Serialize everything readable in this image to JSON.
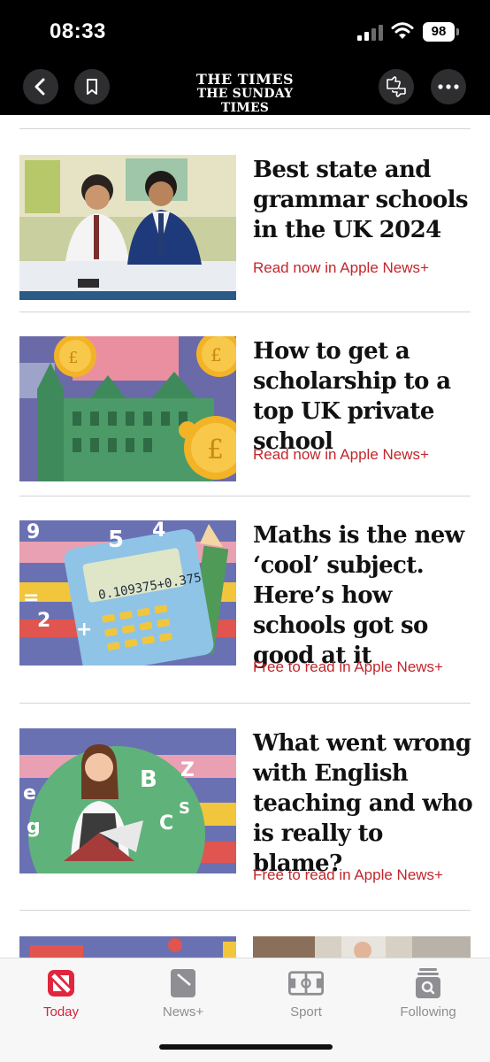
{
  "status_bar": {
    "time": "08:33",
    "battery": "98"
  },
  "header": {
    "masthead_line1": "THE TIMES",
    "masthead_line2": "THE SUNDAY TIMES",
    "icons": [
      "chevron-left-icon",
      "bookmark-icon",
      "thumbs-icon",
      "more-icon"
    ]
  },
  "articles": [
    {
      "headline": "Best state and grammar schools in the UK 2024",
      "cta": "Read now in Apple News+"
    },
    {
      "headline": "How to get a scholarship to a top UK private school",
      "cta": "Read now in Apple News+"
    },
    {
      "headline": "Maths is the new ‘cool’ subject. Here’s how schools got so good at it",
      "cta": "Free to read in Apple News+"
    },
    {
      "headline": "What went wrong with English teaching and who is really to blame?",
      "cta": "Free to read in Apple News+"
    }
  ],
  "tabbar": {
    "tabs": [
      {
        "label": "Today",
        "icon": "apple-news-icon",
        "active": true
      },
      {
        "label": "News+",
        "icon": "news-plus-icon",
        "active": false
      },
      {
        "label": "Sport",
        "icon": "sport-icon",
        "active": false
      },
      {
        "label": "Following",
        "icon": "following-icon",
        "active": false
      }
    ]
  },
  "colors": {
    "accent_red": "#c1262b",
    "tab_active": "#d8213e",
    "header_bg": "#000000"
  }
}
